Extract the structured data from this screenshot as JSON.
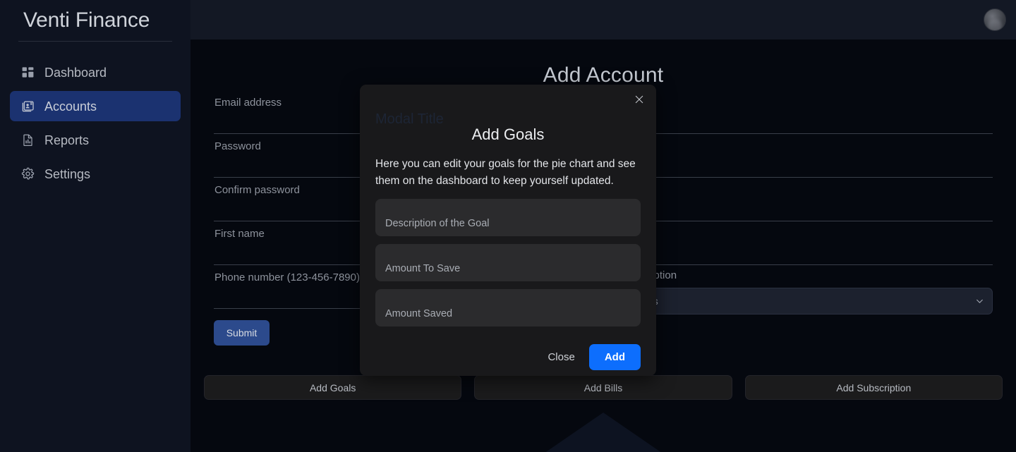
{
  "app": {
    "brand": "Venti Finance"
  },
  "sidebar": {
    "items": [
      {
        "label": "Dashboard",
        "icon": "grid-icon",
        "active": false
      },
      {
        "label": "Accounts",
        "icon": "address-card-icon",
        "active": true
      },
      {
        "label": "Reports",
        "icon": "file-chart-icon",
        "active": false
      },
      {
        "label": "Settings",
        "icon": "gear-icon",
        "active": false
      }
    ]
  },
  "topbar": {
    "avatar_icon": "user-avatar"
  },
  "main": {
    "page_title": "Add Account",
    "left_fields": [
      {
        "label": "Email address",
        "value": ""
      },
      {
        "label": "Password",
        "value": ""
      },
      {
        "label": "Confirm password",
        "value": ""
      },
      {
        "label": "First name",
        "value": ""
      },
      {
        "label": "Phone number (123-456-7890)",
        "value": ""
      }
    ],
    "right_fields": [
      {
        "label": "",
        "value": ""
      },
      {
        "label": "",
        "value": ""
      },
      {
        "label": "",
        "value": ""
      },
      {
        "label": "",
        "value": ""
      }
    ],
    "select": {
      "label": "Select Option",
      "value": "Savings",
      "caret_icon": "chevron-down-icon"
    },
    "submit_label": "Submit",
    "bottom_actions": [
      {
        "label": "Add Goals"
      },
      {
        "label": "Add Bills"
      },
      {
        "label": "Add Subscription"
      }
    ]
  },
  "modal": {
    "ghost_title": "Modal Title",
    "close_icon": "close-icon",
    "title": "Add Goals",
    "description": "Here you can edit your goals for the pie chart and see them on the dashboard to keep yourself updated.",
    "inputs": [
      {
        "placeholder": "Description of the Goal",
        "value": ""
      },
      {
        "placeholder": "Amount To Save",
        "value": ""
      },
      {
        "placeholder": "Amount Saved",
        "value": ""
      }
    ],
    "close_label": "Close",
    "add_label": "Add"
  },
  "colors": {
    "accent_blue": "#0d6efd",
    "sidebar_active": "#1b3270",
    "submit_blue": "#2c4a8c",
    "page_bg": "#05080f",
    "sidebar_bg": "#0e1320",
    "modal_bg": "#19191b",
    "input_bg": "#2b2b2d"
  }
}
